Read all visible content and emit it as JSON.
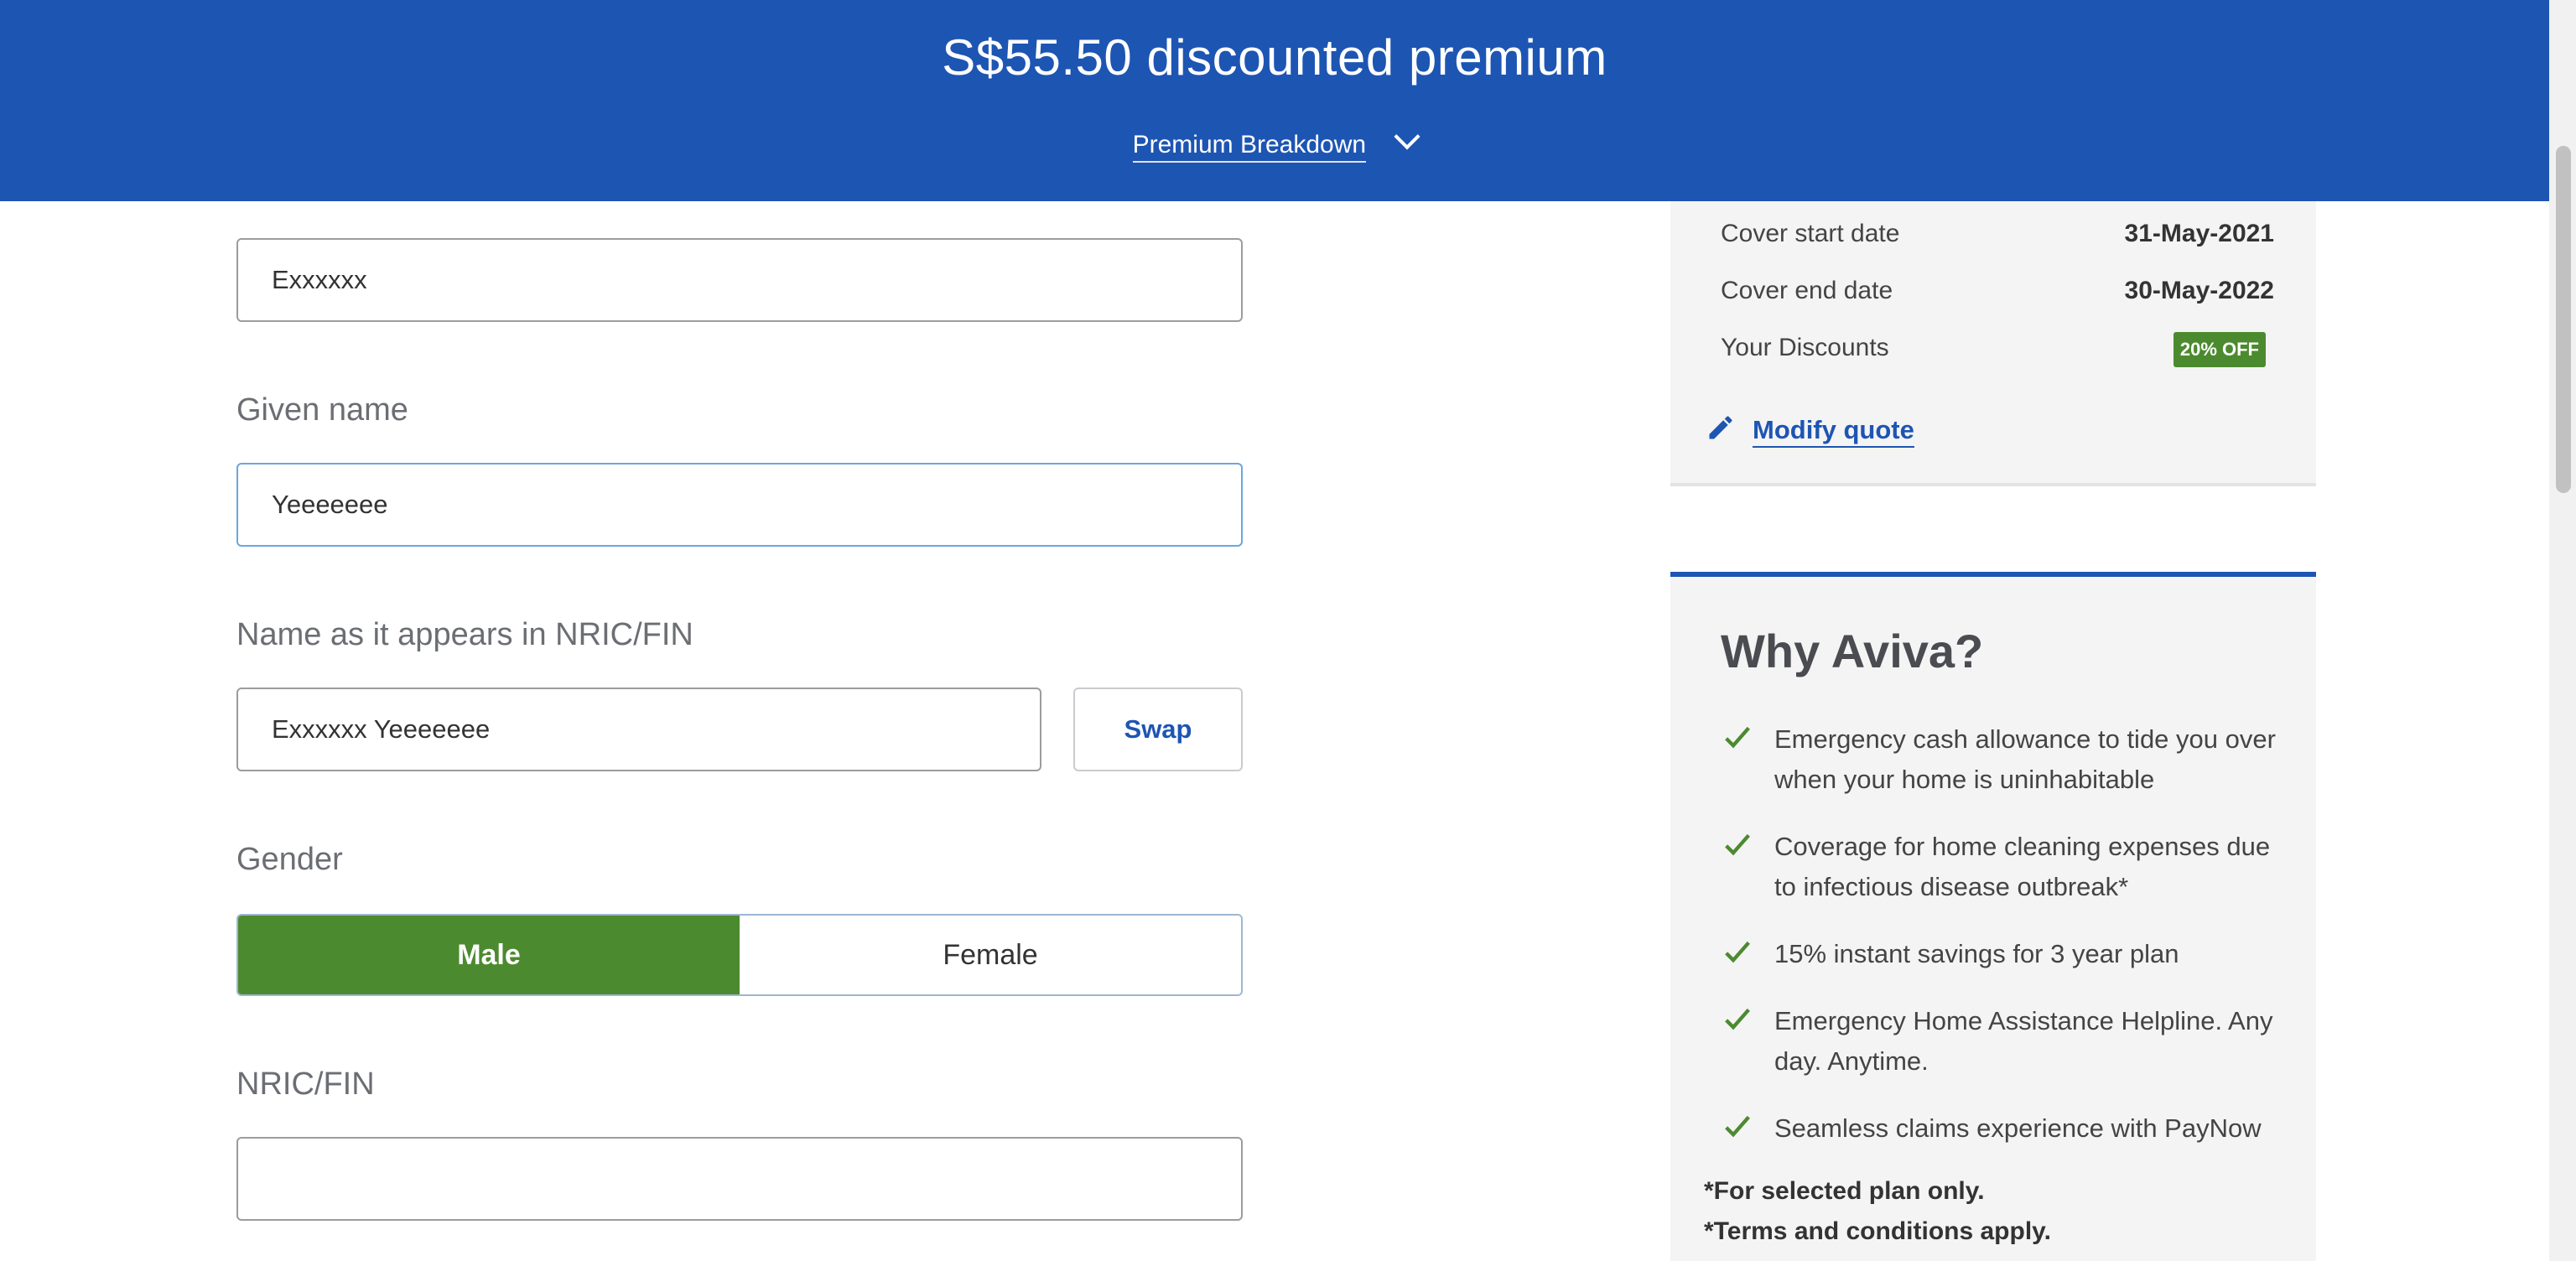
{
  "header": {
    "amount": "S$55.50",
    "premium_text": "discounted premium",
    "breakdown_label": "Premium Breakdown"
  },
  "form": {
    "surname_value": "Exxxxxx",
    "given_name_label": "Given name",
    "given_name_value": "Yeeeeeee",
    "nric_name_label": "Name as it appears in NRIC/FIN",
    "nric_name_value": "Exxxxxx Yeeeeeee",
    "swap_label": "Swap",
    "gender_label": "Gender",
    "gender_options": [
      "Male",
      "Female"
    ],
    "gender_selected": "Male",
    "nric_label": "NRIC/FIN",
    "nric_value": ""
  },
  "summary": {
    "cover_start_label": "Cover start date",
    "cover_start_value": "31-May-2021",
    "cover_end_label": "Cover end date",
    "cover_end_value": "30-May-2022",
    "discounts_label": "Your Discounts",
    "discount_badge": "20% OFF",
    "modify_label": "Modify quote"
  },
  "why": {
    "title": "Why Aviva?",
    "items": [
      "Emergency cash allowance to tide you over when your home is uninhabitable",
      "Coverage for home cleaning expenses due to infectious disease outbreak*",
      "15% instant savings for 3 year plan",
      "Emergency Home Assistance Helpline. Any day. Anytime.",
      "Seamless claims experience with PayNow"
    ],
    "footnote_1": "*For selected plan only.",
    "footnote_2": "*Terms and conditions apply."
  },
  "colors": {
    "brand_blue": "#1d55b3",
    "selected_green": "#4c8a2f"
  }
}
